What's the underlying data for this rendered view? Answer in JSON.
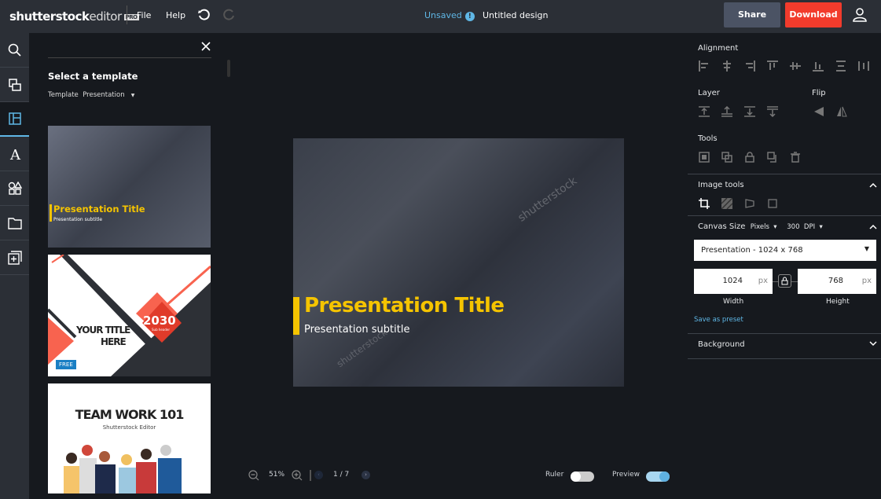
{
  "header": {
    "logo_main": "shutterstock",
    "logo_editor": "editor",
    "logo_badge": "PRO",
    "file": "File",
    "help": "Help",
    "unsaved": "Unsaved",
    "info": "!",
    "document_title": "Untitled design",
    "share": "Share",
    "download": "Download"
  },
  "sidebar": {
    "items": [
      "search",
      "layers",
      "templates",
      "text",
      "elements",
      "folder",
      "add-page"
    ]
  },
  "panel": {
    "heading": "Select a template",
    "filter_label": "Template",
    "filter_value": "Presentation",
    "templates": [
      {
        "title": "Presentation Title",
        "subtitle": "Presentation subtitle"
      },
      {
        "title_line1": "YOUR TITLE",
        "title_line2": "HERE",
        "year": "2030",
        "subheader": "Sub header",
        "badge": "FREE"
      },
      {
        "title": "TEAM WORK 101",
        "subtitle": "Shutterstock Editor"
      }
    ]
  },
  "canvas": {
    "title": "Presentation Title",
    "subtitle": "Presentation subtitle",
    "watermark": "shutterstock",
    "accent": "#f5c400"
  },
  "right": {
    "alignment": "Alignment",
    "layer": "Layer",
    "flip": "Flip",
    "tools": "Tools",
    "image_tools": "Image tools",
    "canvas_size": "Canvas Size",
    "unit": "Pixels",
    "dpi_value": "300",
    "dpi": "DPI",
    "preset": "Presentation - 1024 x 768",
    "width": "1024",
    "height": "768",
    "px": "px",
    "width_label": "Width",
    "height_label": "Height",
    "save_preset": "Save as preset",
    "background": "Background"
  },
  "bottom": {
    "zoom": "51%",
    "page": "1 / 7",
    "ruler": "Ruler",
    "preview": "Preview",
    "ruler_on": false,
    "preview_on": true
  }
}
